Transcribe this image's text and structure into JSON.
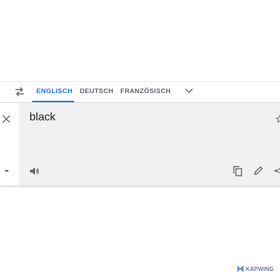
{
  "toolbar": {
    "tabs": [
      {
        "label": "ENGLISCH",
        "active": true
      },
      {
        "label": "DEUTSCH",
        "active": false
      },
      {
        "label": "FRANZÖSISCH",
        "active": false
      }
    ],
    "swap_icon": "swap-arrows-icon",
    "more_icon": "chevron-down-icon"
  },
  "input": {
    "value": "black",
    "icons": [
      "close-icon",
      "star-icon",
      "speaker-icon",
      "copy-icon",
      "edit-icon",
      "share-icon"
    ]
  },
  "watermark": {
    "text": "KAPWING"
  },
  "colors": {
    "accent": "#1a73e8",
    "panel_bg": "#f1f1f1",
    "icon": "#5f6368"
  }
}
